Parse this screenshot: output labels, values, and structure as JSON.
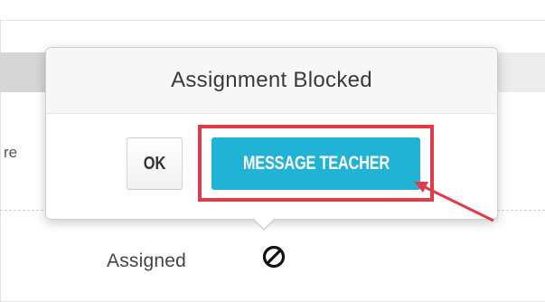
{
  "background": {
    "cut_text": "re",
    "status_text": "Assigned",
    "status_icon": "blocked-icon"
  },
  "popover": {
    "title": "Assignment Blocked",
    "ok_label": "OK",
    "message_label": "MESSAGE TEACHER"
  },
  "annotation": {
    "highlight_color": "#e23a46",
    "arrow_color": "#e23a46"
  },
  "colors": {
    "primary_button": "#20b3d6"
  }
}
